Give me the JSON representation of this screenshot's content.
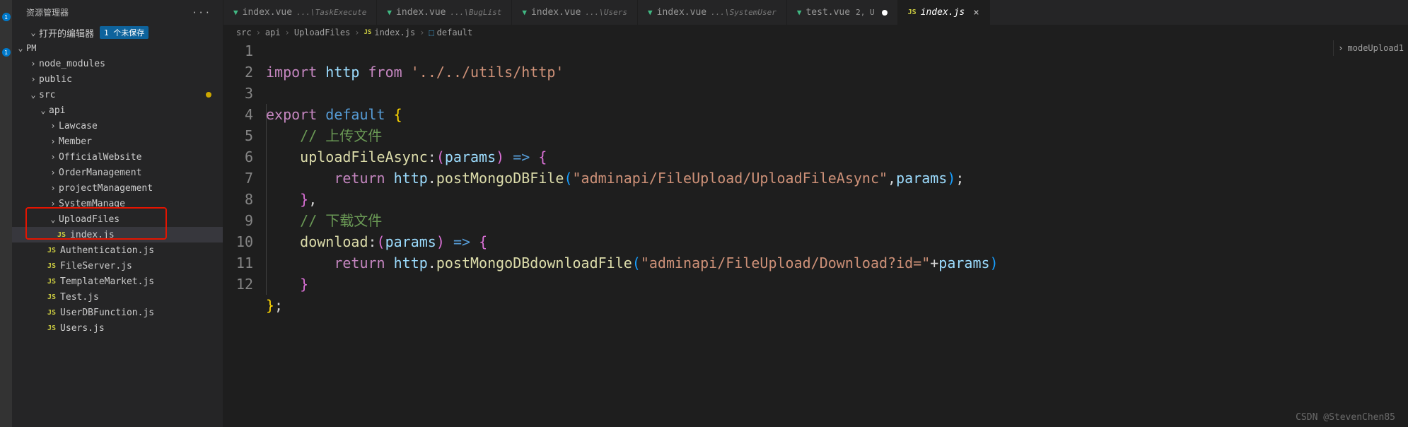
{
  "sidebar": {
    "title": "资源管理器",
    "openEditorsLabel": "打开的编辑器",
    "unsavedBadge": "1 个未保存",
    "root": "PM",
    "tree": [
      {
        "label": "node_modules",
        "depth": 1,
        "chev": "›"
      },
      {
        "label": "public",
        "depth": 1,
        "chev": "›"
      },
      {
        "label": "src",
        "depth": 1,
        "chev": "⌄",
        "mod": true
      },
      {
        "label": "api",
        "depth": 2,
        "chev": "⌄"
      },
      {
        "label": "Lawcase",
        "depth": 3,
        "chev": "›"
      },
      {
        "label": "Member",
        "depth": 3,
        "chev": "›"
      },
      {
        "label": "OfficialWebsite",
        "depth": 3,
        "chev": "›"
      },
      {
        "label": "OrderManagement",
        "depth": 3,
        "chev": "›"
      },
      {
        "label": "projectManagement",
        "depth": 3,
        "chev": "›"
      },
      {
        "label": "SystemManage",
        "depth": 3,
        "chev": "›"
      },
      {
        "label": "UploadFiles",
        "depth": 3,
        "chev": "⌄",
        "active": false
      },
      {
        "label": "index.js",
        "depth": 4,
        "file": "js",
        "active": true
      },
      {
        "label": "Authentication.js",
        "depth": 3,
        "file": "js"
      },
      {
        "label": "FileServer.js",
        "depth": 3,
        "file": "js"
      },
      {
        "label": "TemplateMarket.js",
        "depth": 3,
        "file": "js"
      },
      {
        "label": "Test.js",
        "depth": 3,
        "file": "js"
      },
      {
        "label": "UserDBFunction.js",
        "depth": 3,
        "file": "js"
      },
      {
        "label": "Users.js",
        "depth": 3,
        "file": "js"
      }
    ]
  },
  "tabs": [
    {
      "name": "index.vue",
      "path": "...\\TaskExecute",
      "type": "vue"
    },
    {
      "name": "index.vue",
      "path": "...\\BugList",
      "type": "vue"
    },
    {
      "name": "index.vue",
      "path": "...\\Users",
      "type": "vue"
    },
    {
      "name": "index.vue",
      "path": "...\\SystemUser",
      "type": "vue"
    },
    {
      "name": "test.vue",
      "git": "2, U",
      "type": "vue",
      "modified": true
    },
    {
      "name": "index.js",
      "type": "js",
      "active": true,
      "italic": true
    }
  ],
  "breadcrumb": [
    "src",
    "api",
    "UploadFiles",
    "index.js",
    "default"
  ],
  "rightBreadcrumb": "modeUpload1",
  "code": {
    "lines": [
      1,
      2,
      3,
      4,
      5,
      6,
      7,
      8,
      9,
      10,
      11,
      12
    ],
    "l1_import": "import",
    "l1_http": "http",
    "l1_from": "from",
    "l1_str": "'../../utils/http'",
    "l3_export": "export",
    "l3_default": "default",
    "l4_cmt": "// 上传文件",
    "l5_fn": "uploadFileAsync",
    "l5_params": "params",
    "l6_return": "return",
    "l6_http": "http",
    "l6_method": "postMongoDBFile",
    "l6_str": "\"adminapi/FileUpload/UploadFileAsync\"",
    "l6_params": "params",
    "l8_cmt": "// 下载文件",
    "l9_fn": "download",
    "l9_params": "params",
    "l10_return": "return",
    "l10_http": "http",
    "l10_method": "postMongoDBdownloadFile",
    "l10_str": "\"adminapi/FileUpload/Download?id=\"",
    "l10_params": "params"
  },
  "watermark": "CSDN @StevenChen85"
}
